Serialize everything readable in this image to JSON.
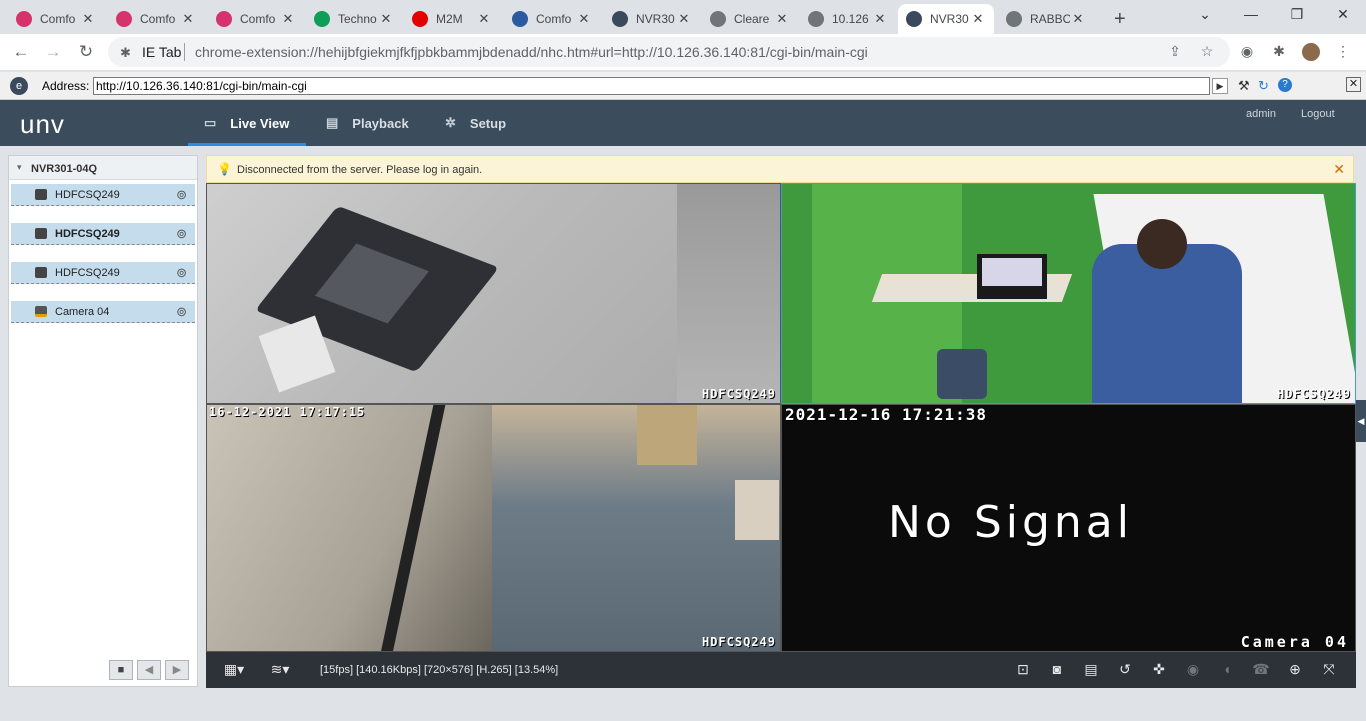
{
  "browser": {
    "tabs": [
      {
        "title": "Comfo",
        "favicon": "comfo-icon",
        "color": "#d6336c"
      },
      {
        "title": "Comfo",
        "favicon": "comfo-icon",
        "color": "#d6336c"
      },
      {
        "title": "Comfo",
        "favicon": "comfo-icon",
        "color": "#d6336c"
      },
      {
        "title": "Techno",
        "favicon": "sheets-icon",
        "color": "#0f9d58"
      },
      {
        "title": "M2M",
        "favicon": "airtel-icon",
        "color": "#e40000"
      },
      {
        "title": "Comfo",
        "favicon": "y-icon",
        "color": "#2c5aa0"
      },
      {
        "title": "NVR30",
        "favicon": "ie-tab-icon",
        "color": "#3a4a5c"
      },
      {
        "title": "Cleare",
        "favicon": "globe-icon",
        "color": "#70757a"
      },
      {
        "title": "10.126",
        "favicon": "globe-icon",
        "color": "#70757a"
      },
      {
        "title": "NVR30",
        "favicon": "ie-tab-icon",
        "color": "#3a4a5c"
      },
      {
        "title": "RABBO",
        "favicon": "globe-icon",
        "color": "#70757a"
      }
    ],
    "active_tab_index": 9,
    "new_tab": "+",
    "extension_label": "IE Tab",
    "url": "chrome-extension://hehijbfgiekmjfkfjpbkbammjbdenadd/nhc.htm#url=http://10.126.36.140:81/cgi-bin/main-cgi"
  },
  "ietab": {
    "address_label": "Address:",
    "address_value": "http://10.126.36.140:81/cgi-bin/main-cgi"
  },
  "app": {
    "logo": "unv",
    "menu": [
      {
        "label": "Live View",
        "icon": "monitor-icon"
      },
      {
        "label": "Playback",
        "icon": "film-icon"
      },
      {
        "label": "Setup",
        "icon": "gear-icon"
      }
    ],
    "user": "admin",
    "logout": "Logout"
  },
  "tree": {
    "device": "NVR301-04Q",
    "channels": [
      {
        "name": "HDFCSQ249",
        "bold": false
      },
      {
        "name": "HDFCSQ249",
        "bold": true
      },
      {
        "name": "HDFCSQ249",
        "bold": false
      },
      {
        "name": "Camera 04",
        "bold": false
      }
    ]
  },
  "notice": {
    "message": "Disconnected from the server. Please log in again."
  },
  "video": {
    "cells": [
      {
        "timestamp": "",
        "label": "HDFCSQ249"
      },
      {
        "timestamp": "",
        "label": "HDFCSQ249"
      },
      {
        "timestamp": "16-12-2021 17:17:15",
        "label": "HDFCSQ249"
      },
      {
        "timestamp": "2021-12-16 17:21:38",
        "label": "Camera 04",
        "center_text": "No Signal"
      }
    ]
  },
  "status": {
    "stream_info": "[15fps] [140.16Kbps] [720×576] [H.265] [13.54%]"
  }
}
